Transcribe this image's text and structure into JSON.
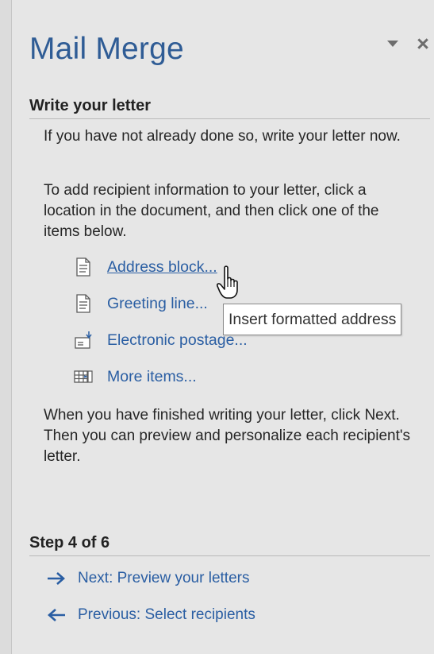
{
  "pane": {
    "title": "Mail Merge",
    "pin_icon": "dropdown-arrow-icon",
    "close_label": "×"
  },
  "section": {
    "heading": "Write your letter",
    "intro": "If you have not already done so, write your letter now.",
    "instruction": "To add recipient information to your letter, click a location in the document, and then click one of the items below.",
    "items": [
      {
        "label": "Address block...",
        "icon": "document-icon"
      },
      {
        "label": "Greeting line...",
        "icon": "document-icon"
      },
      {
        "label": "Electronic postage...",
        "icon": "postage-icon"
      },
      {
        "label": "More items...",
        "icon": "table-icon"
      }
    ],
    "finish_text": "When you have finished writing your letter, click Next. Then you can preview and personalize each recipient's letter."
  },
  "tooltip": {
    "text": "Insert formatted address"
  },
  "step": {
    "heading": "Step 4 of 6",
    "next_label": "Next: Preview your letters",
    "previous_label": "Previous: Select recipients"
  },
  "colors": {
    "title": "#2f5c95",
    "link": "#2a5ea3",
    "pane_bg": "#e6e6e6"
  }
}
